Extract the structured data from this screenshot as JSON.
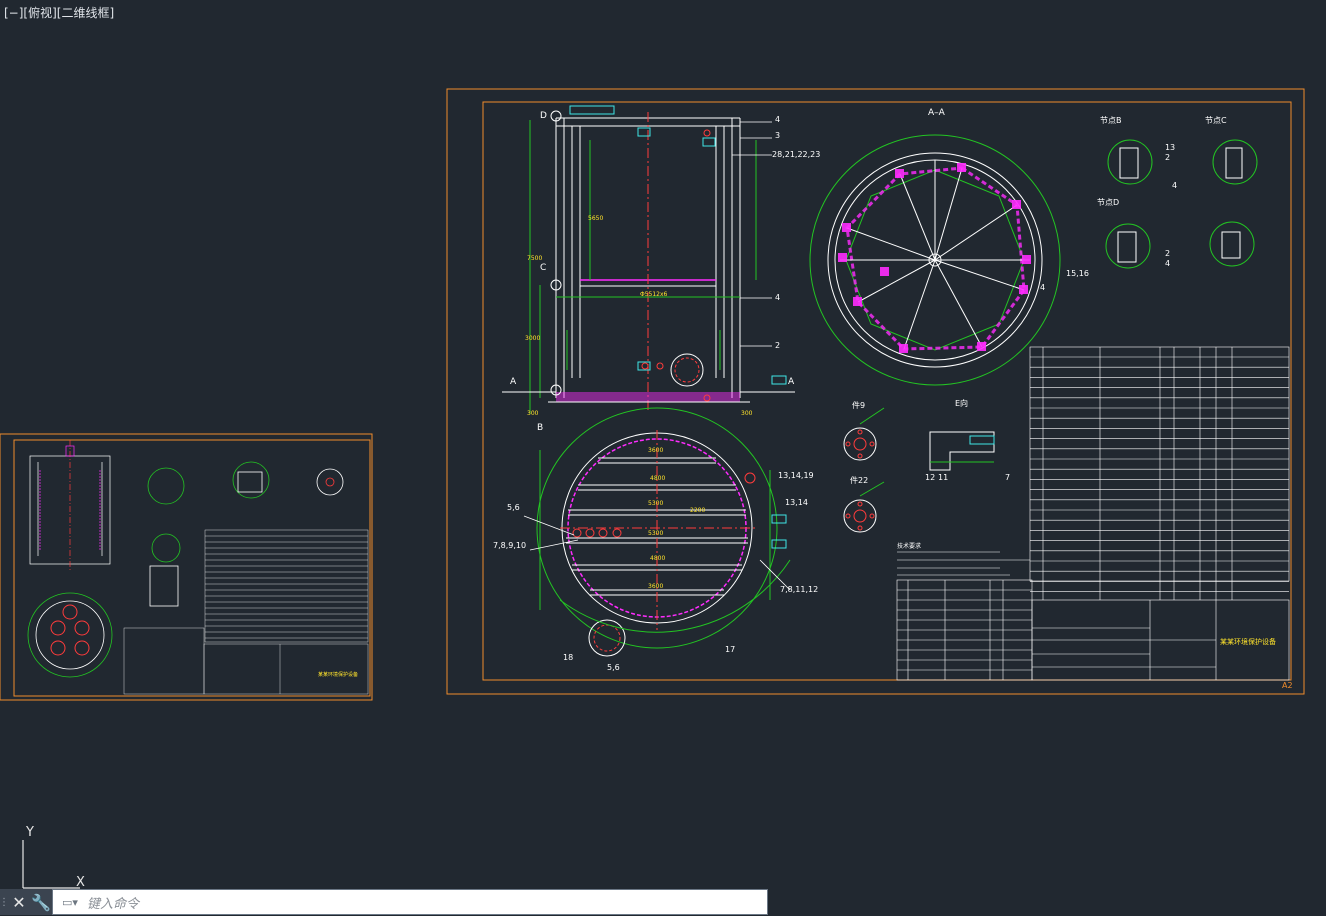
{
  "viewport": {
    "label": "[−][俯视][二维线框]"
  },
  "ucs": {
    "y_label": "Y",
    "x_label": "X"
  },
  "command_line": {
    "placeholder": "键入命令",
    "close_label": "✕",
    "settings_label": "🔧"
  },
  "sheet_main": {
    "section_title": "A–A",
    "section_left": "A",
    "section_right": "A",
    "label_b": "B",
    "label_c": "C",
    "label_d": "D",
    "sheet_size": "A2",
    "detail_e": "E向",
    "detail_b": "节点B",
    "detail_c": "节点C",
    "detail_d": "节点D",
    "detail_9": "件9",
    "detail_22": "件22",
    "title_name": "某某环境保护设备",
    "callouts": [
      "4",
      "3",
      "28,21,22,23",
      "4",
      "2",
      "15,16",
      "4",
      "13,14,19",
      "5,6",
      "7,8,9,10",
      "13,14",
      "7,8,11,12",
      "18",
      "17",
      "5,6",
      "12",
      "11",
      "7",
      "1",
      "2",
      "3",
      "4",
      "2",
      "4"
    ],
    "dims": [
      "3600",
      "4800",
      "5300",
      "5300",
      "4800",
      "3600",
      "2200",
      "Φ5512x6",
      "7500",
      "5650",
      "3000",
      "300",
      "300"
    ],
    "notes_title": "技术要求"
  },
  "sheet_small": {
    "title_name": "某某环境保护设备"
  },
  "colors": {
    "background": "#212830",
    "frame": "#f08c2c",
    "white": "#ffffff",
    "green": "#23c423",
    "magenta": "#ff2cff",
    "red": "#ff3c3c",
    "cyan": "#3ee6e6",
    "yellow": "#ffe32c"
  }
}
